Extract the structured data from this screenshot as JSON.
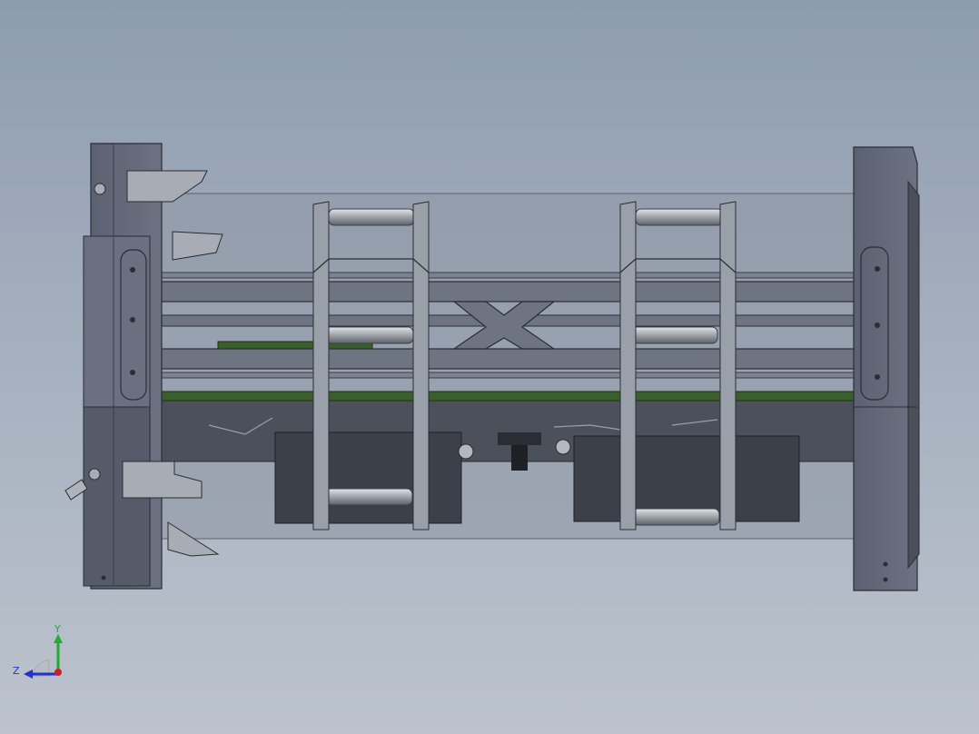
{
  "viewport": {
    "background_top": "#8e9cb0",
    "background_bottom": "#bcc3cd"
  },
  "model": {
    "body_color": "#5e6472",
    "frame_color": "#6e7482",
    "edge_color": "#2a2d34",
    "pcb_color": "#3b5f2c",
    "glass_color": "#9aa1ad",
    "roller_color": "#b8bcc2"
  },
  "triad": {
    "y_label": "Y",
    "z_label": "Z",
    "y_color": "#22aa33",
    "z_color": "#2233cc",
    "x_color": "#cc2222"
  }
}
